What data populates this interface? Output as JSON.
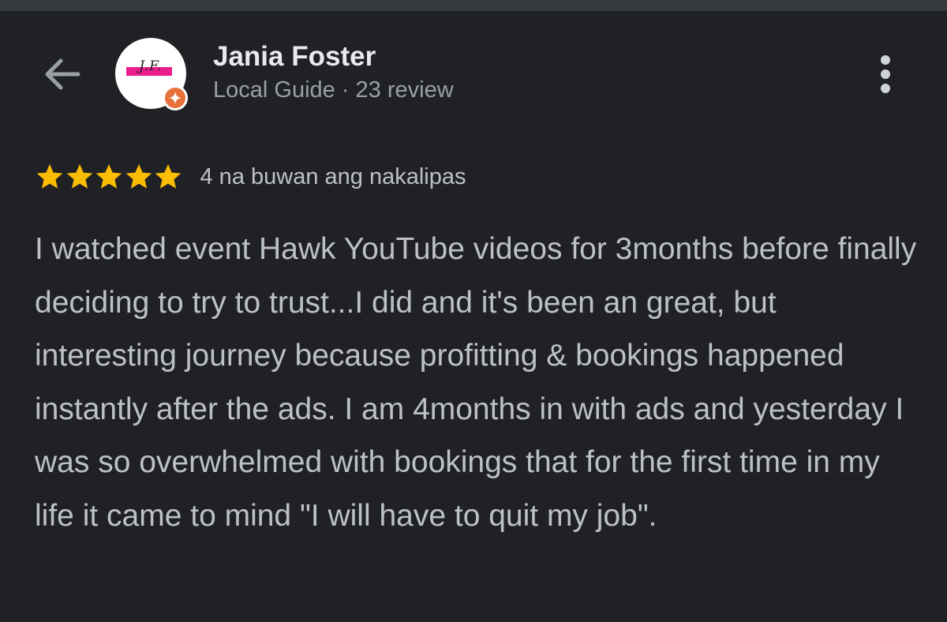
{
  "header": {
    "user_name": "Jania Foster",
    "user_meta": "Local Guide · 23 review",
    "avatar_initials": "J.F."
  },
  "review": {
    "rating": 5,
    "rating_max": 5,
    "date": "4 na buwan ang nakalipas",
    "text": "I watched event Hawk YouTube videos for 3months before finally deciding to try to trust...I did and it's been an great, but interesting journey because profitting & bookings happened instantly after the ads. I am 4months in with ads and yesterday I was so overwhelmed with bookings that for the first time in my life it came to mind \"I will have to quit my job\"."
  },
  "icons": {
    "back": "arrow-back-icon",
    "more": "more-vert-icon",
    "star": "star-icon",
    "local_guide": "local-guide-badge-icon"
  },
  "colors": {
    "background": "#202124",
    "star": "#fbbc04",
    "badge": "#e8703a",
    "avatar_mark": "#e91e8c",
    "name_text": "#e8eaed",
    "secondary_text": "#9aa0a6",
    "body_text": "#bdc1c6"
  }
}
